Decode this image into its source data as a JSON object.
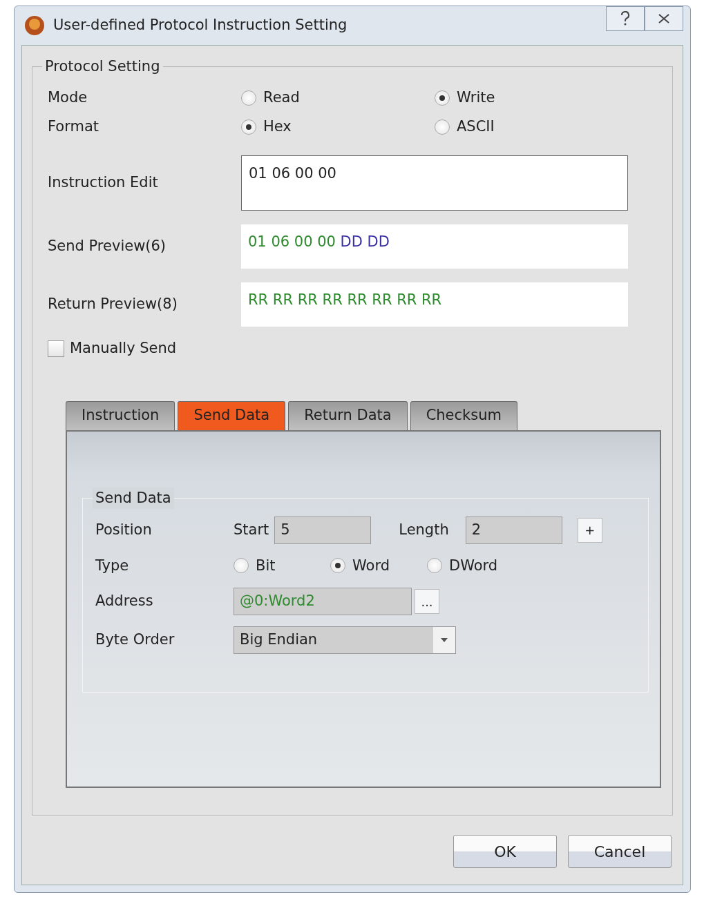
{
  "window": {
    "title": "User-defined Protocol Instruction Setting"
  },
  "protocol_setting": {
    "title": "Protocol Setting",
    "mode": {
      "label": "Mode",
      "options": [
        {
          "label": "Read",
          "selected": false
        },
        {
          "label": "Write",
          "selected": true
        }
      ]
    },
    "format": {
      "label": "Format",
      "options": [
        {
          "label": "Hex",
          "selected": true
        },
        {
          "label": "ASCII",
          "selected": false
        }
      ]
    },
    "instruction_edit": {
      "label": "Instruction Edit",
      "value": "01 06 00 00"
    },
    "send_preview": {
      "label": "Send Preview(6)",
      "segments": [
        {
          "text": "01 06 00 00",
          "color": "#2e8b2e"
        },
        {
          "text": "DD DD",
          "color": "#3a2fa0"
        }
      ]
    },
    "return_preview": {
      "label": "Return Preview(8)",
      "segments": [
        {
          "text": "RR RR RR RR RR RR RR RR",
          "color": "#2e8b2e"
        }
      ]
    },
    "manually_send": {
      "label": "Manually Send",
      "checked": false
    }
  },
  "tabs": [
    {
      "label": "Instruction",
      "selected": false
    },
    {
      "label": "Send Data",
      "selected": true
    },
    {
      "label": "Return Data",
      "selected": false
    },
    {
      "label": "Checksum",
      "selected": false
    }
  ],
  "send_data": {
    "title": "Send Data",
    "position": {
      "label": "Position",
      "start_label": "Start",
      "start_value": "5",
      "length_label": "Length",
      "length_value": "2",
      "add_button": "+"
    },
    "type": {
      "label": "Type",
      "options": [
        {
          "label": "Bit",
          "selected": false
        },
        {
          "label": "Word",
          "selected": true
        },
        {
          "label": "DWord",
          "selected": false
        }
      ]
    },
    "address": {
      "label": "Address",
      "value": "@0:Word2",
      "browse_button": "..."
    },
    "byte_order": {
      "label": "Byte Order",
      "value": "Big Endian"
    }
  },
  "buttons": [
    "OK",
    "Cancel"
  ]
}
